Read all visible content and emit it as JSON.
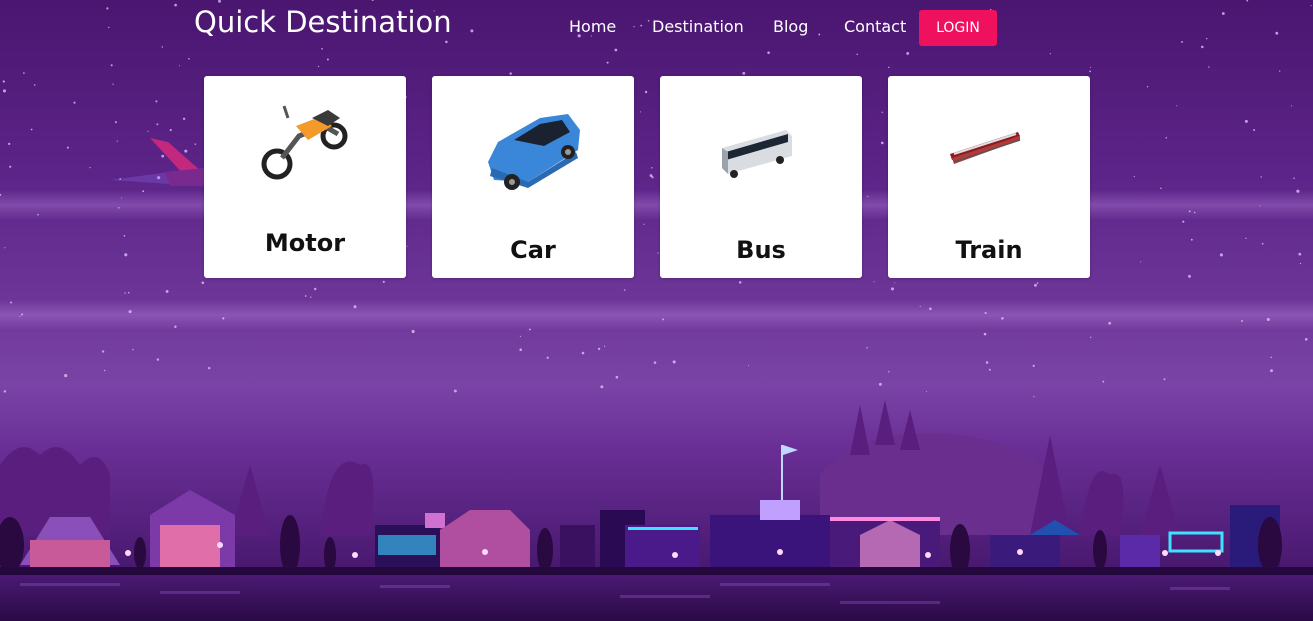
{
  "brand": "Quick Destination",
  "nav": {
    "items": [
      "Home",
      "Destination",
      "Blog",
      "Contact"
    ],
    "login_label": "LOGIN"
  },
  "cards": [
    {
      "label": "Motor",
      "icon": "motorcycle-icon"
    },
    {
      "label": "Car",
      "icon": "car-icon"
    },
    {
      "label": "Bus",
      "icon": "bus-icon"
    },
    {
      "label": "Train",
      "icon": "train-icon"
    }
  ],
  "colors": {
    "accent": "#f0115e",
    "sky_top": "#4a1670",
    "sky_mid": "#7a43a6",
    "card_bg": "#ffffff"
  }
}
